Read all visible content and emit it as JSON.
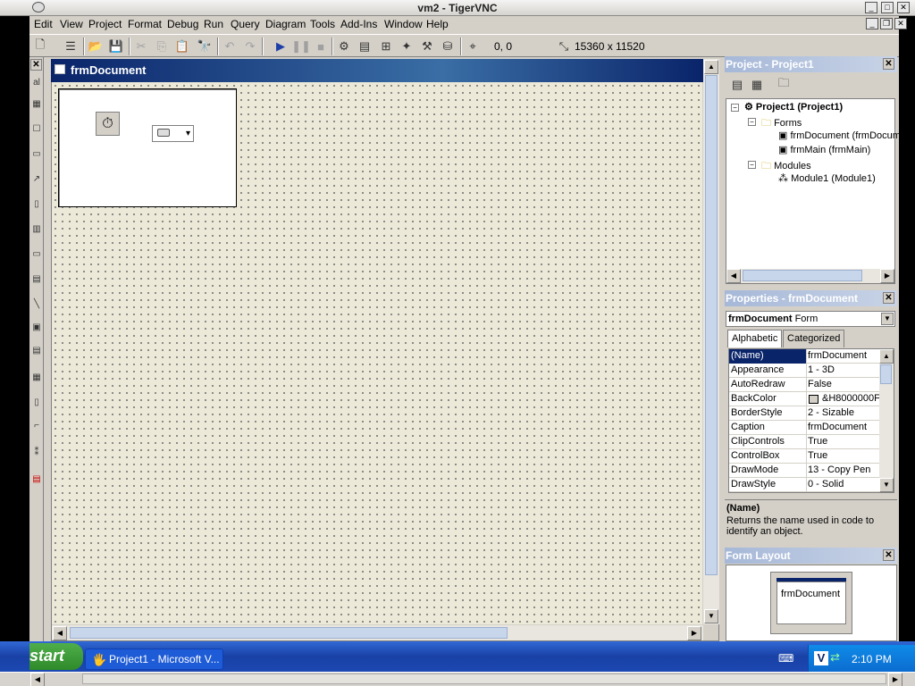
{
  "vnc": {
    "title": "vm2 - TigerVNC"
  },
  "menu": [
    "Edit",
    "View",
    "Project",
    "Format",
    "Debug",
    "Run",
    "Query",
    "Diagram",
    "Tools",
    "Add-Ins",
    "Window",
    "Help"
  ],
  "toolbar": {
    "position": "0, 0",
    "size": "15360 x 11520"
  },
  "designer": {
    "title": "frmDocument"
  },
  "project_explorer": {
    "title": "Project - Project1",
    "root": "Project1 (Project1)",
    "forms_folder": "Forms",
    "form1": "frmDocument (frmDocument)",
    "form2": "frmMain (frmMain)",
    "modules_folder": "Modules",
    "module1": "Module1 (Module1)"
  },
  "properties": {
    "title": "Properties - frmDocument",
    "object_name": "frmDocument",
    "object_type": "Form",
    "tab_alpha": "Alphabetic",
    "tab_cat": "Categorized",
    "rows": [
      {
        "name": "(Name)",
        "value": "frmDocument"
      },
      {
        "name": "Appearance",
        "value": "1 - 3D"
      },
      {
        "name": "AutoRedraw",
        "value": "False"
      },
      {
        "name": "BackColor",
        "value": "&H8000000F"
      },
      {
        "name": "BorderStyle",
        "value": "2 - Sizable"
      },
      {
        "name": "Caption",
        "value": "frmDocument"
      },
      {
        "name": "ClipControls",
        "value": "True"
      },
      {
        "name": "ControlBox",
        "value": "True"
      },
      {
        "name": "DrawMode",
        "value": "13 - Copy Pen"
      },
      {
        "name": "DrawStyle",
        "value": "0 - Solid"
      }
    ],
    "desc_title": "(Name)",
    "desc_text": "Returns the name used in code to identify an object."
  },
  "form_layout": {
    "title": "Form Layout",
    "form_label": "frmDocument"
  },
  "taskbar": {
    "start": "start",
    "task": "Project1 - Microsoft V...",
    "clock": "2:10 PM"
  },
  "colors": {
    "titlebar": "#0a246a",
    "panel_title": "#a6b8d8",
    "taskbar": "#245edb"
  }
}
